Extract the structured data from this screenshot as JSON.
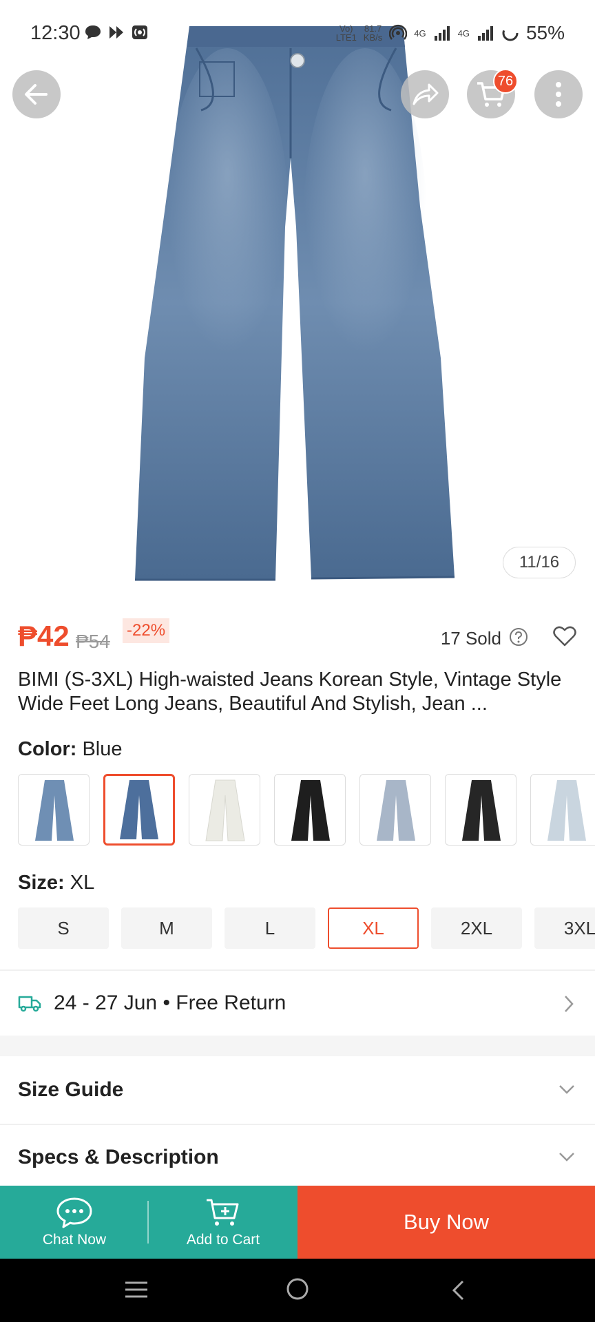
{
  "status": {
    "time": "12:30",
    "net_speed_top": "81.7",
    "net_speed_bottom": "KB/s",
    "volte_top": "Vo)",
    "volte_bottom": "LTE1",
    "sig1": "4G",
    "sig2": "4G",
    "battery": "55%"
  },
  "header": {
    "cart_count": "76"
  },
  "gallery": {
    "counter": "11/16"
  },
  "product": {
    "price": "₱42",
    "original_price": "₱54",
    "discount": "-22%",
    "sold": "17 Sold",
    "title": "BIMI (S-3XL) High-waisted Jeans Korean Style, Vintage Style Wide Feet Long Jeans, Beautiful And Stylish, Jean ..."
  },
  "variation": {
    "color_label": "Color:",
    "color_value": "Blue",
    "swatches": [
      {
        "color": "#6f8fb4"
      },
      {
        "color": "#4d6f9c"
      },
      {
        "color": "#ececE6"
      },
      {
        "color": "#1e1e1e"
      },
      {
        "color": "#a8b6c8"
      },
      {
        "color": "#262626"
      },
      {
        "color": "#c9d5df"
      }
    ],
    "size_label": "Size:",
    "size_value": "XL",
    "sizes": [
      "S",
      "M",
      "L",
      "XL",
      "2XL",
      "3XL"
    ]
  },
  "delivery": {
    "text": "24 - 27 Jun • Free Return"
  },
  "sections": {
    "size_guide": "Size Guide",
    "specs": "Specs & Description"
  },
  "actions": {
    "chat": "Chat Now",
    "add_to_cart": "Add to Cart",
    "buy": "Buy Now"
  },
  "colors": {
    "accent": "#ee4d2d",
    "teal": "#26aa99"
  }
}
